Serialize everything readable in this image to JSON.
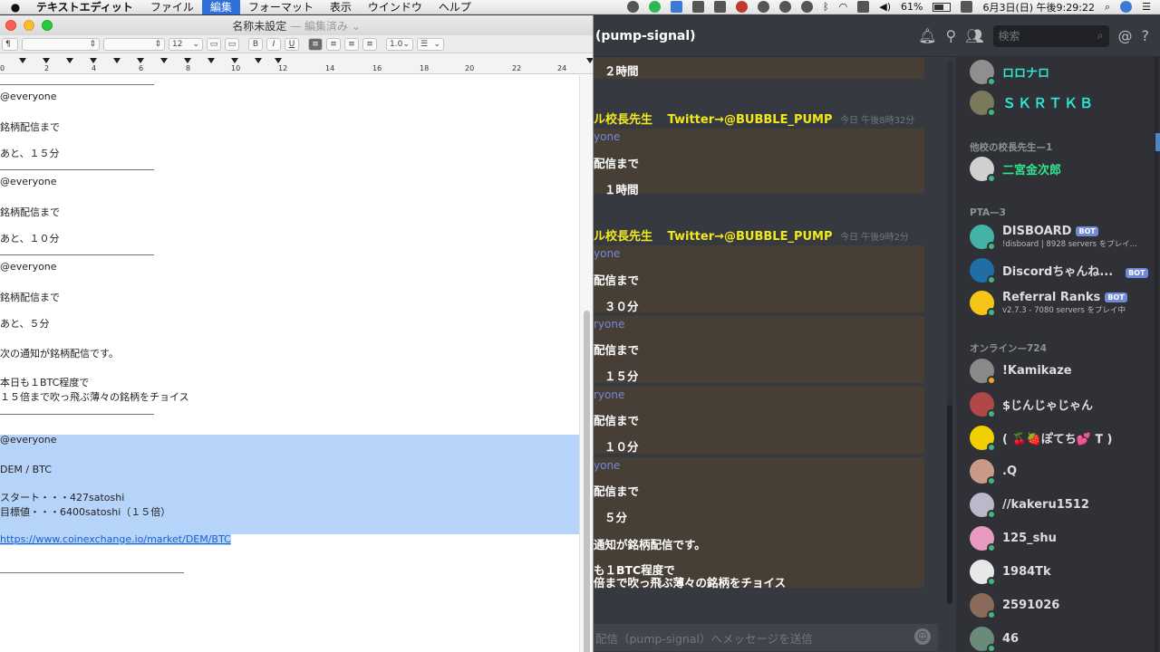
{
  "menubar": {
    "app_name": "テキストエディット",
    "menus": [
      "ファイル",
      "編集",
      "フォーマット",
      "表示",
      "ウインドウ",
      "ヘルプ"
    ],
    "active_menu_index": 1,
    "battery": "61%",
    "datetime": "6月3日(日) 午後9:29:22"
  },
  "textedit": {
    "title": "名称未設定",
    "title_status": "— 編集済み ⌄",
    "toolbar": {
      "paragraph_style": "¶",
      "font_size": "12",
      "line_spacing": "1.0"
    },
    "ruler_numbers": [
      "0",
      "2",
      "4",
      "6",
      "8",
      "10",
      "12",
      "14",
      "16",
      "18",
      "20",
      "22",
      "24"
    ],
    "lines": [
      "@everyone",
      "銘柄配信まで",
      "あと、１５分",
      "@everyone",
      "銘柄配信まで",
      "あと、１０分",
      "@everyone",
      "銘柄配信まで",
      "あと、５分",
      "次の通知が銘柄配信です。",
      "本日も１BTC程度で",
      "１５倍まで吹っ飛ぶ薄々の銘柄をチョイス",
      "@everyone",
      "DEM / BTC",
      "スタート・・・427satoshi",
      "目標値・・・6400satoshi（１５倍）",
      "https://www.coinexchange.io/market/DEM/BTC"
    ]
  },
  "discord": {
    "channel": "(pump-signal)",
    "search_placeholder": "検索",
    "messages": {
      "top_fragment": "２時間",
      "msg1": {
        "author": "ル校長先生",
        "twitter": "Twitter→@BUBBLE_PUMP",
        "timestamp": "今日 午後8時32分",
        "mention": "yone",
        "line1": "配信まで",
        "line2": "１時間"
      },
      "msg2": {
        "author": "ル校長先生",
        "twitter": "Twitter→@BUBBLE_PUMP",
        "timestamp": "今日 午後9時2分",
        "embeds": [
          {
            "mention": "yone",
            "line1": "配信まで",
            "line2": "３０分"
          },
          {
            "mention": "ryone",
            "line1": "配信まで",
            "line2": "１５分"
          },
          {
            "mention": "ryone",
            "line1": "配信まで",
            "line2": "１０分"
          },
          {
            "mention": "yone",
            "line1": "配信まで",
            "line2": "５分"
          }
        ],
        "final1": "通知が銘柄配信です。",
        "final2": "も１BTC程度で",
        "final3": "倍まで吹っ飛ぶ薄々の銘柄をチョイス"
      }
    },
    "input_placeholder": "配信（pump-signal）へメッセージを送信",
    "members": {
      "top": [
        {
          "name": "ロロナロ",
          "color": "#2ee6d6",
          "avatar": "#8f8f8f"
        },
        {
          "name": "ＳＫＲＴＫＢ",
          "color": "#2ee6d6",
          "avatar": "#7a7a5a"
        }
      ],
      "cat1": "他校の校長先生—1",
      "cat1_members": [
        {
          "name": "二宮金次郎",
          "color": "#2ee68e",
          "avatar": "#d0d0d0"
        }
      ],
      "cat2": "PTA—3",
      "cat2_members": [
        {
          "name": "DISBOARD",
          "bot": "BOT",
          "sub": "!disboard | 8928 servers をプレイ...",
          "avatar": "#43b3a6"
        },
        {
          "name": "Discordちゃんね...",
          "bot": "BOT",
          "avatar": "#1f6ea6"
        },
        {
          "name": "Referral Ranks",
          "bot": "BOT",
          "sub": "v2.7.3 - 7080 servers をプレイ中",
          "avatar": "#f5c518"
        }
      ],
      "cat3": "オンライン—724",
      "online": [
        {
          "name": "!Kamikaze",
          "avatar": "#8a8a8a"
        },
        {
          "name": "$じんじゃじゃん",
          "avatar": "#b04848"
        },
        {
          "name": "( 🍒🍓ぽてち💕 𝐓 )",
          "avatar": "#f0d000"
        },
        {
          "name": ".Q",
          "avatar": "#c99a8a"
        },
        {
          "name": "//kakeru1512",
          "avatar": "#b9b9c9"
        },
        {
          "name": "125_shu",
          "avatar": "#e99ac0"
        },
        {
          "name": "1984Tk",
          "avatar": "#e8e8e8"
        },
        {
          "name": "2591026",
          "avatar": "#8a6a5a"
        },
        {
          "name": "46",
          "avatar": "#6a8a7a"
        }
      ]
    }
  }
}
